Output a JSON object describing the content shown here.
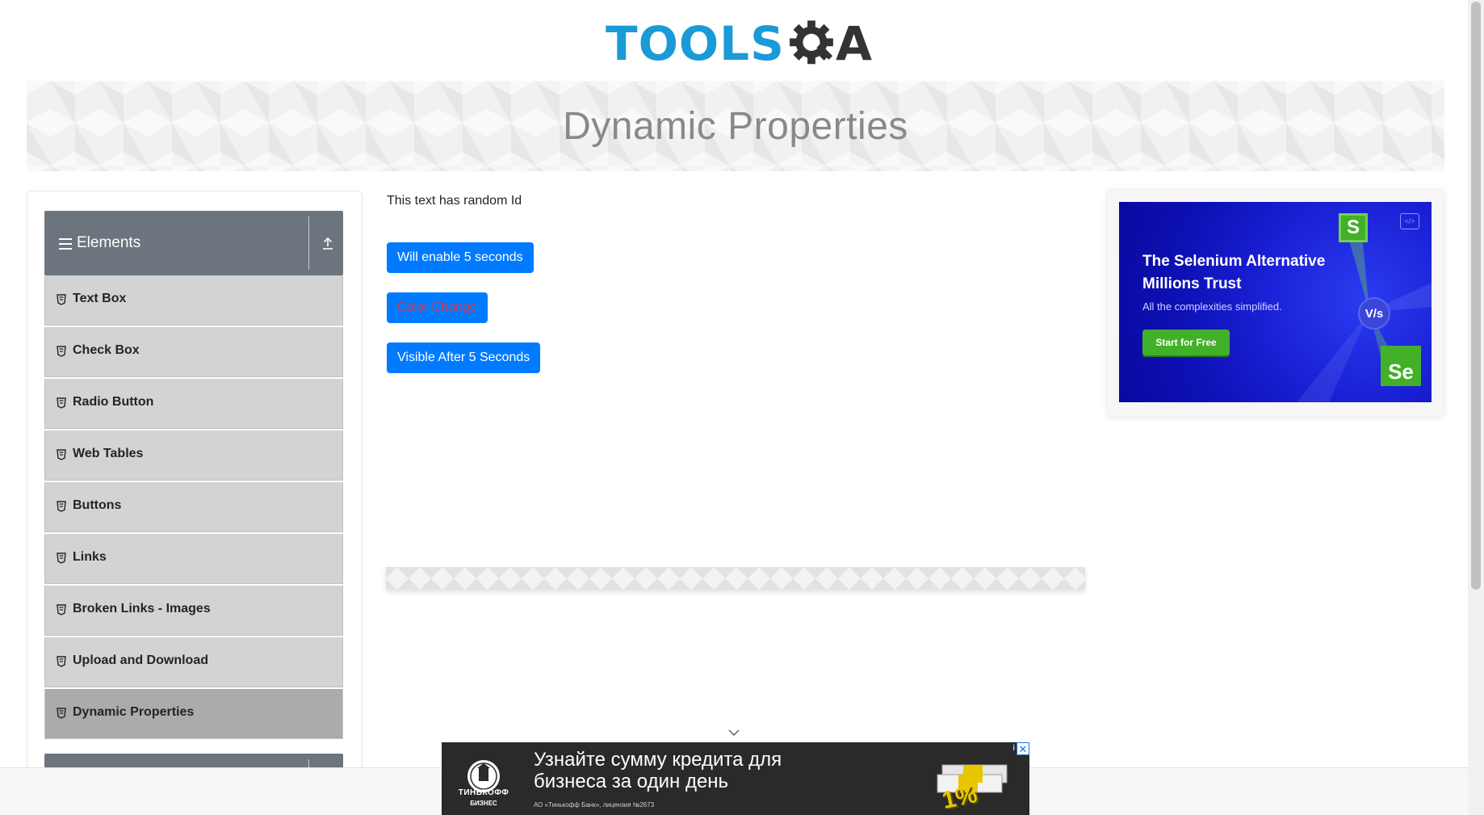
{
  "header": {
    "logo_text": "TOOLS",
    "logo_suffix": "A",
    "page_title": "Dynamic Properties"
  },
  "sidebar": {
    "group_label": "Elements",
    "items": [
      {
        "label": "Text Box"
      },
      {
        "label": "Check Box"
      },
      {
        "label": "Radio Button"
      },
      {
        "label": "Web Tables"
      },
      {
        "label": "Buttons"
      },
      {
        "label": "Links"
      },
      {
        "label": "Broken Links - Images"
      },
      {
        "label": "Upload and Download"
      },
      {
        "label": "Dynamic Properties"
      }
    ],
    "active_item": "Dynamic Properties"
  },
  "main": {
    "random_text": "This text has random Id",
    "enable_button": "Will enable 5 seconds",
    "color_button": "Color Change",
    "visible_button": "Visible After 5 Seconds"
  },
  "right_ad": {
    "title": "The Selenium Alternative Millions Trust",
    "subtitle": "All the complexities simplified.",
    "cta": "Start for Free",
    "badge_s": "S",
    "badge_vs": "V/s",
    "badge_se": "Se",
    "code_icon": "</>"
  },
  "bottom_ad": {
    "headline": "Узнайте сумму кредита для бизнеса за один день",
    "bank_name": "ТИНЬКОФФ",
    "bank_sub": "БИЗНЕС",
    "fine_print": "АО «Тинькофф Банк», лицензия №2673",
    "percent": "1%",
    "info_icon": "i",
    "close_icon": "✕"
  },
  "colors": {
    "primary": "#007bff",
    "color_change_text": "#dc3545",
    "sidebar_header": "#6c757d",
    "menu_item": "#d3d3d3",
    "menu_item_active": "#ababab",
    "logo_blue": "#1a9ad6"
  }
}
